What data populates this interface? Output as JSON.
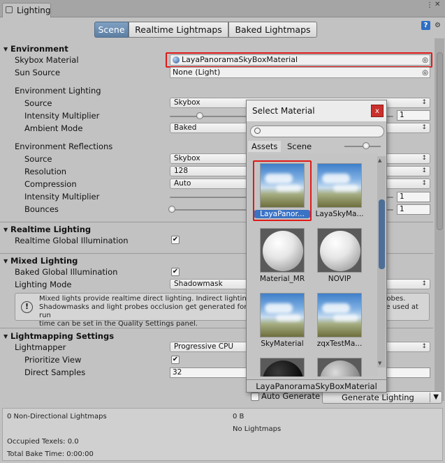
{
  "window": {
    "tab": "Lighting"
  },
  "toolbar": {
    "tabs": [
      "Scene",
      "Realtime Lightmaps",
      "Baked Lightmaps"
    ],
    "active": "Scene"
  },
  "environment": {
    "header": "Environment",
    "skybox_label": "Skybox Material",
    "skybox_value": "LayaPanoramaSkyBoxMaterial",
    "sun_label": "Sun Source",
    "sun_value": "None (Light)",
    "lighting_header": "Environment Lighting",
    "source_label": "Source",
    "source_value": "Skybox",
    "intensity_label": "Intensity Multiplier",
    "intensity_value": "1",
    "ambient_label": "Ambient Mode",
    "ambient_value": "Baked",
    "reflections_header": "Environment Reflections",
    "ref_source_label": "Source",
    "ref_source_value": "Skybox",
    "resolution_label": "Resolution",
    "resolution_value": "128",
    "compression_label": "Compression",
    "compression_value": "Auto",
    "ref_intensity_label": "Intensity Multiplier",
    "ref_intensity_value": "1",
    "bounces_label": "Bounces",
    "bounces_value": "1"
  },
  "realtime": {
    "header": "Realtime Lighting",
    "gi_label": "Realtime Global Illumination"
  },
  "mixed": {
    "header": "Mixed Lighting",
    "baked_gi_label": "Baked Global Illumination",
    "mode_label": "Lighting Mode",
    "mode_value": "Shadowmask",
    "help_line1": "Mixed lights provide realtime direct lighting. Indirect lighting gets baked into lightmaps and light probes.",
    "help_line2": "Shadowmasks and light probes occlusion get generated for baked shadows. The Shadowmask Mode used at run",
    "help_line3": "time can be set in the Quality Settings panel."
  },
  "lightmapping": {
    "header": "Lightmapping Settings",
    "lightmapper_label": "Lightmapper",
    "lightmapper_value": "Progressive CPU",
    "prioritize_label": "Prioritize View",
    "direct_label": "Direct Samples",
    "direct_value": "32"
  },
  "generate": {
    "auto_label": "Auto Generate",
    "button_label": "Generate Lighting"
  },
  "stats": {
    "lightmaps": "0 Non-Directional Lightmaps",
    "size": "0 B",
    "no_lightmaps": "No Lightmaps",
    "texels": "Occupied Texels: 0.0",
    "bake_time": "Total Bake Time: 0:00:00"
  },
  "popup": {
    "title": "Select Material",
    "close": "x",
    "tabs": [
      "Assets",
      "Scene"
    ],
    "items": [
      {
        "label": "LayaPanor...",
        "kind": "sky"
      },
      {
        "label": "LayaSkyMa...",
        "kind": "sky"
      },
      {
        "label": "Material_MR",
        "kind": "sphere-white"
      },
      {
        "label": "NOVIP",
        "kind": "sphere-white"
      },
      {
        "label": "SkyMaterial",
        "kind": "sky"
      },
      {
        "label": "zqxTestMa...",
        "kind": "sky"
      },
      {
        "label": "",
        "kind": "sphere-black"
      },
      {
        "label": "",
        "kind": "sphere-grey"
      }
    ],
    "selected_name": "LayaPanoramaSkyBoxMaterial"
  },
  "icons": [
    "help-icon",
    "picker-icon",
    "info-icon",
    "search-icon",
    "close-icon"
  ]
}
